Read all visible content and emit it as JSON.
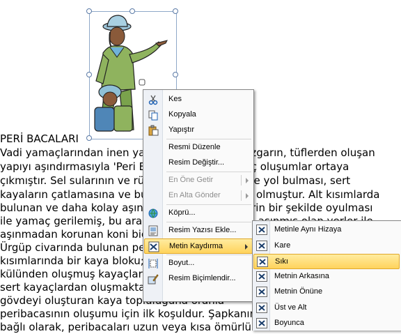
{
  "document": {
    "lines": [
      "PERİ BACALARI",
      "   Vadi yamaçlarından inen yağmur sularının ve rüzgarın, tüflerden oluşan",
      "yapıyı aşındırmasıyla 'Peri Bacaları' denilen ilginç oluşumlar ortaya",
      "çıkmıştır. Sel sularının ve rüzgarın vadiye dendine yol bulması, sert",
      "kayaların çatlamasına ve bu çatlaklardan oluşan olmuştur. Alt kısımlarda",
      "bulunan ve daha kolay aşınan tüfler ise daha derin bir şekilde oyulması",
      "ile yamaç gerilemiş, bu arada kapağı ile korunan aşınmış olan yerler ile",
      "aşınmadan korunan koni biçimli peri bacaları ile",
      "Ürgüp civarında bulunan peri bacalarının üst",
      "kısımlarında bir kaya bloku; alt kısımları ise",
      "külünden oluşmuş kayaçlardan, başlık kısımları",
      "sert kayaçlardan oluşmaktadır. Yani şapkayı",
      "gövdeyi oluşturan kaya topluluğuna oranla",
      "peribacasının oluşumu için ilk koşuldur. Şapkanın",
      "bağlı olarak, peribacaları uzun veya kısa ömürlü"
    ]
  },
  "context_menu": {
    "items": [
      {
        "label": "Kes",
        "icon": "scissors-icon",
        "disabled": false
      },
      {
        "label": "Kopyala",
        "icon": "copy-icon",
        "disabled": false
      },
      {
        "label": "Yapıştır",
        "icon": "paste-icon",
        "disabled": false
      },
      {
        "label": "Resmi Düzenle",
        "icon": "",
        "disabled": false
      },
      {
        "label": "Resim Değiştir...",
        "icon": "",
        "disabled": false
      },
      {
        "label": "En Öne Getir",
        "icon": "",
        "disabled": true
      },
      {
        "label": "En Alta Gönder",
        "icon": "",
        "disabled": true
      },
      {
        "label": "Köprü...",
        "icon": "hyperlink-icon",
        "disabled": false
      },
      {
        "label": "Resim Yazısı Ekle...",
        "icon": "caption-icon",
        "disabled": false
      },
      {
        "label": "Metin Kaydırma",
        "icon": "text-wrap-icon",
        "disabled": false
      },
      {
        "label": "Boyut...",
        "icon": "size-icon",
        "disabled": false
      },
      {
        "label": "Resim Biçimlendir...",
        "icon": "format-picture-icon",
        "disabled": false
      }
    ]
  },
  "wrap_submenu": {
    "items": [
      {
        "label": "Metinle Aynı Hizaya",
        "icon": "inline-with-text-icon"
      },
      {
        "label": "Kare",
        "icon": "square-wrap-icon"
      },
      {
        "label": "Sıkı",
        "icon": "tight-wrap-icon"
      },
      {
        "label": "Metnin Arkasına",
        "icon": "behind-text-icon"
      },
      {
        "label": "Metnin Önüne",
        "icon": "in-front-of-text-icon"
      },
      {
        "label": "Üst ve Alt",
        "icon": "top-bottom-wrap-icon"
      },
      {
        "label": "Boyunca",
        "icon": "through-wrap-icon"
      }
    ],
    "highlighted": "Sıkı"
  },
  "colors": {
    "menu_highlight": "#ffd35c",
    "selection_handle": "#5a7aa6",
    "rotate_handle": "#7ccd3a"
  }
}
